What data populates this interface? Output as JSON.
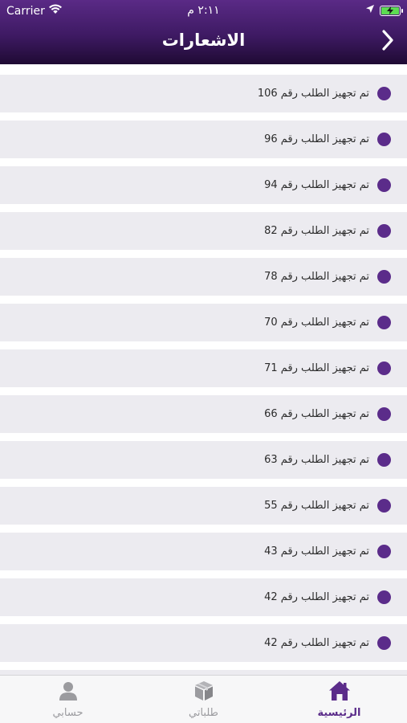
{
  "status_bar": {
    "carrier": "Carrier",
    "time": "٢:١١ م"
  },
  "header": {
    "title": "الاشعارات"
  },
  "notifications": [
    {
      "text": "تم تجهيز الطلب رقم 106"
    },
    {
      "text": "تم تجهيز الطلب رقم 96"
    },
    {
      "text": "تم تجهيز الطلب رقم 94"
    },
    {
      "text": "تم تجهيز الطلب رقم 82"
    },
    {
      "text": "تم تجهيز الطلب رقم 78"
    },
    {
      "text": "تم تجهيز الطلب رقم 70"
    },
    {
      "text": "تم تجهيز الطلب رقم 71"
    },
    {
      "text": "تم تجهيز الطلب رقم 66"
    },
    {
      "text": "تم تجهيز الطلب رقم 63"
    },
    {
      "text": "تم تجهيز الطلب رقم 55"
    },
    {
      "text": "تم تجهيز الطلب رقم 43"
    },
    {
      "text": "تم تجهيز الطلب رقم 42"
    },
    {
      "text": "تم تجهيز الطلب رقم 42"
    }
  ],
  "tabbar": {
    "home": {
      "label": "الرئيسية",
      "icon": "home-icon",
      "active": true
    },
    "orders": {
      "label": "طلباتي",
      "icon": "package-icon",
      "active": false
    },
    "account": {
      "label": "حسابي",
      "icon": "user-icon",
      "active": false
    }
  },
  "colors": {
    "brand": "#5b2c8a",
    "header_top": "#5a2a86",
    "header_bottom": "#1f0a33",
    "row_bg": "#ecebf0",
    "inactive_tab": "#9b9b9f"
  }
}
